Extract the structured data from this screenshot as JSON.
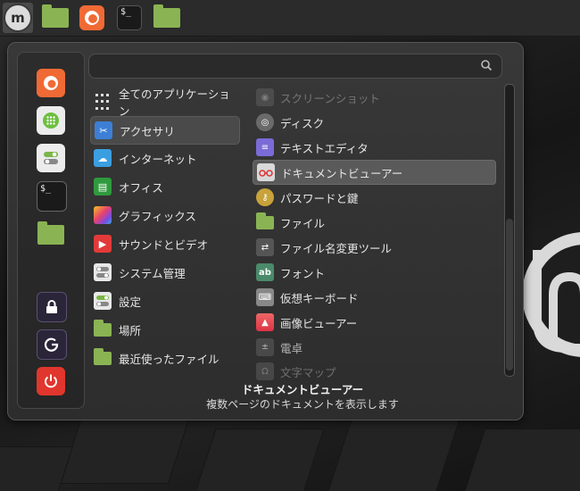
{
  "panel": {
    "launchers": [
      {
        "name": "menu-icon"
      },
      {
        "name": "folder-icon"
      },
      {
        "name": "firefox-icon"
      },
      {
        "name": "terminal-icon",
        "text": "$_"
      },
      {
        "name": "folder-icon"
      }
    ]
  },
  "sidebar": {
    "terminal_text": "$_"
  },
  "search": {
    "placeholder": ""
  },
  "categories": [
    {
      "label": "全てのアプリケーション",
      "icon": "grid-icon"
    },
    {
      "label": "アクセサリ",
      "icon": "scissors-icon",
      "selected": true
    },
    {
      "label": "インターネット",
      "icon": "cloud-icon"
    },
    {
      "label": "オフィス",
      "icon": "office-icon"
    },
    {
      "label": "グラフィックス",
      "icon": "graphics-icon"
    },
    {
      "label": "サウンドとビデオ",
      "icon": "play-icon"
    },
    {
      "label": "システム管理",
      "icon": "toggles-icon"
    },
    {
      "label": "設定",
      "icon": "settings-toggle-icon"
    },
    {
      "label": "場所",
      "icon": "folder-icon"
    },
    {
      "label": "最近使ったファイル",
      "icon": "recent-folder-icon"
    }
  ],
  "apps": [
    {
      "label": "スクリーンショット",
      "icon": "camera-icon"
    },
    {
      "label": "ディスク",
      "icon": "disk-icon"
    },
    {
      "label": "テキストエディタ",
      "icon": "text-editor-icon"
    },
    {
      "label": "ドキュメントビューアー",
      "icon": "glasses-icon"
    },
    {
      "label": "パスワードと鍵",
      "icon": "key-icon"
    },
    {
      "label": "ファイル",
      "icon": "folder-icon"
    },
    {
      "label": "ファイル名変更ツール",
      "icon": "rename-icon"
    },
    {
      "label": "フォント",
      "icon": "font-icon",
      "icon_text": "ab"
    },
    {
      "label": "仮想キーボード",
      "icon": "keyboard-icon"
    },
    {
      "label": "画像ビューアー",
      "icon": "image-icon"
    },
    {
      "label": "電卓",
      "icon": "calculator-icon"
    },
    {
      "label": "文字マップ",
      "icon": "charmap-icon"
    }
  ],
  "description": {
    "title": "ドキュメントビューアー",
    "text": "複数ページのドキュメントを表示します"
  },
  "colors": {
    "accent_green": "#8ab453",
    "firefox_orange": "#f06a35",
    "power_red": "#e0362d"
  }
}
